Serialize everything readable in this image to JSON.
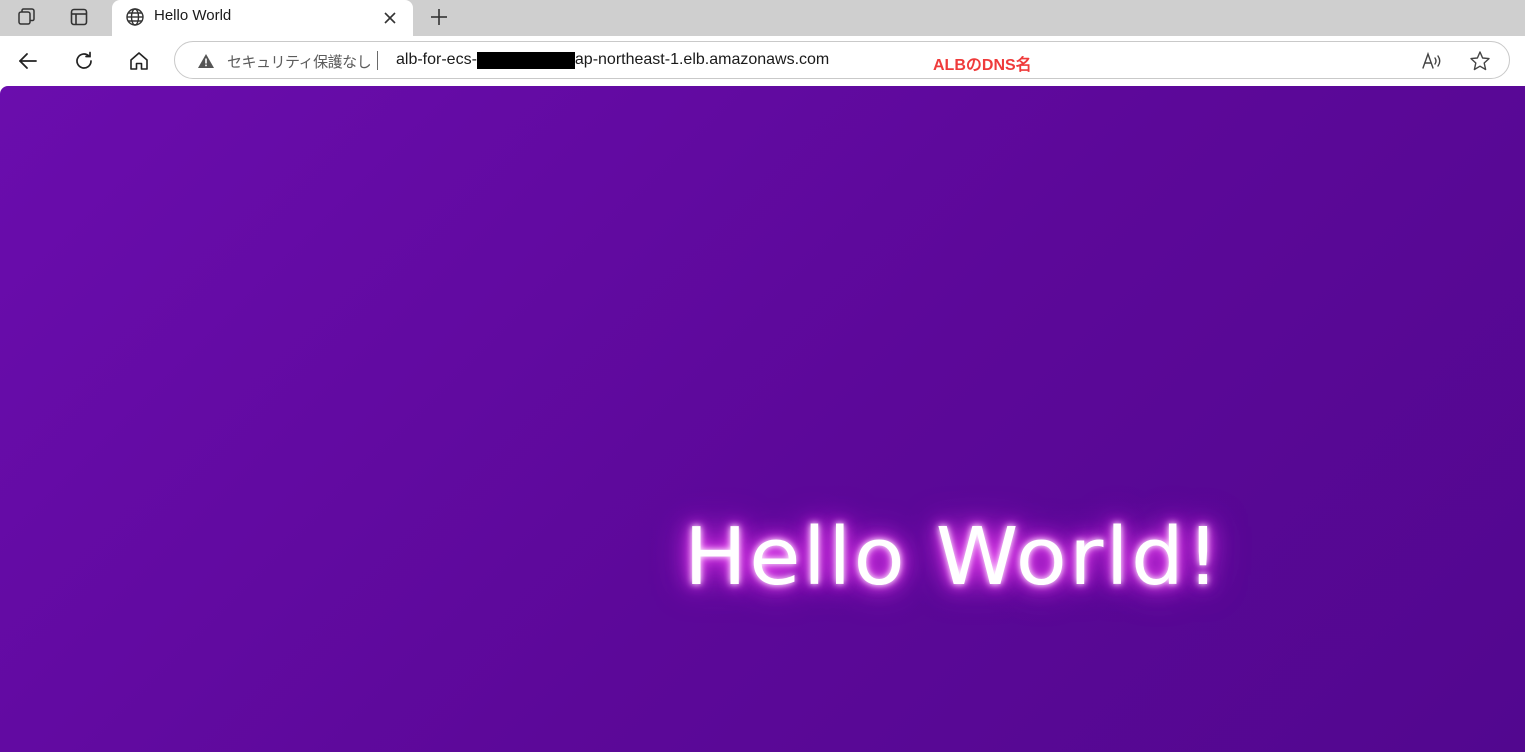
{
  "browser": {
    "tab": {
      "title": "Hello World"
    },
    "icons": {
      "workspaces": "workspaces-icon",
      "tab_actions": "tab-actions-icon",
      "globe": "globe-icon",
      "close": "close-icon",
      "new_tab": "plus-icon",
      "back": "back-arrow-icon",
      "refresh": "refresh-icon",
      "home": "home-icon",
      "warning": "warning-icon",
      "read_aloud": "read-aloud-icon",
      "favorite": "star-icon"
    },
    "address_bar": {
      "security_text": "セキュリティ保護なし",
      "url_prefix": "alb-for-ecs-",
      "url_suffix": "ap-northeast-1.elb.amazonaws.com",
      "annotation": "ALBのDNS名",
      "read_aloud_label": "A⁾"
    }
  },
  "page": {
    "heading": "Hello World!"
  },
  "colors": {
    "tabstrip": "#cfcfcf",
    "page_background": "#5e0a9e",
    "annotation": "#ef3b3b",
    "glow": "#ff3cff"
  }
}
